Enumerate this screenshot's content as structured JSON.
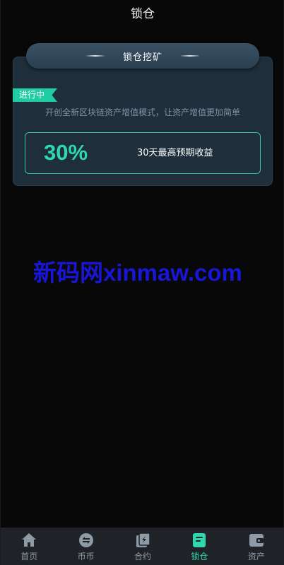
{
  "header": {
    "title": "锁仓"
  },
  "card": {
    "title": "锁仓挖矿",
    "status": "进行中",
    "description": "开创全新区块链资产增值模式，让资产增值更加简单",
    "rate": "30%",
    "rate_label": "30天最高预期收益"
  },
  "watermark": "新码网xinmaw.com",
  "tabbar": {
    "items": [
      {
        "label": "首页",
        "icon": "home-icon"
      },
      {
        "label": "币币",
        "icon": "exchange-icon"
      },
      {
        "label": "合约",
        "icon": "contract-icon"
      },
      {
        "label": "锁仓",
        "icon": "lock-position-icon",
        "active": true
      },
      {
        "label": "资产",
        "icon": "wallet-icon"
      }
    ]
  },
  "colors": {
    "accent": "#2ed9b0",
    "tab_inactive": "#8e9aa6",
    "card_bg": "#1e2e3a",
    "background": "#080808"
  }
}
